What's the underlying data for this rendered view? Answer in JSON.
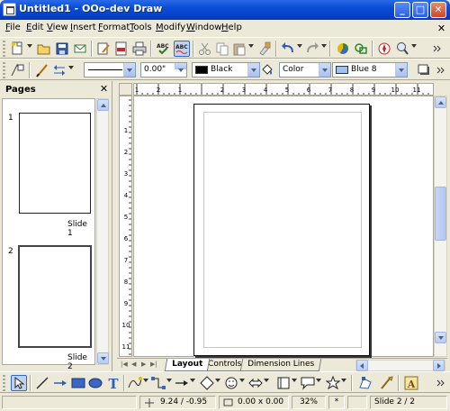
{
  "window": {
    "title": "Untitled1 - OOo-dev Draw",
    "buttons": {
      "minimize": "_",
      "maximize": "□",
      "close": "✕"
    }
  },
  "menu": {
    "items": [
      "File",
      "Edit",
      "View",
      "Insert",
      "Format",
      "Tools",
      "Modify",
      "Window",
      "Help"
    ],
    "close": "✕"
  },
  "line_toolbar": {
    "line_width": "0.00\"",
    "line_color": "Black",
    "area_style": "Color",
    "area_color": "Blue 8",
    "line_color_hex": "#000000",
    "area_color_hex": "#9fc3f0"
  },
  "pages_panel": {
    "title": "Pages",
    "close": "✕",
    "slides": [
      {
        "number": "1",
        "label": "Slide 1"
      },
      {
        "number": "2",
        "label": "Slide 2"
      }
    ]
  },
  "ruler": {
    "h_labels": [
      "1",
      "2",
      "1",
      "2",
      "3",
      "4",
      "5",
      "6",
      "7",
      "8",
      "9",
      "10",
      "11"
    ],
    "v_labels": [
      "1",
      "2",
      "3",
      "4",
      "5",
      "6",
      "7",
      "8",
      "9",
      "10",
      "11"
    ]
  },
  "tabs": [
    "Layout",
    "Controls",
    "Dimension Lines"
  ],
  "status": {
    "position": "9.24 / -0.95",
    "size": "0.00 x 0.00",
    "zoom": "32%",
    "modified": "*",
    "slide": "Slide 2 / 2"
  },
  "icons": {
    "toolbar1": [
      "new-icon",
      "open-icon",
      "save-icon",
      "email-icon",
      "edit-file-icon",
      "export-pdf-icon",
      "print-icon",
      "spellcheck-icon",
      "autospellcheck-icon",
      "cut-icon",
      "copy-icon",
      "paste-icon",
      "clone-format-icon",
      "undo-icon",
      "redo-icon",
      "chart-icon",
      "draw-functions-icon",
      "navigator-icon",
      "zoom-icon"
    ],
    "drawing": [
      "select-icon",
      "line-icon",
      "arrow-line-icon",
      "rectangle-icon",
      "ellipse-icon",
      "text-icon",
      "curve-icon",
      "connector-icon",
      "lines-arrows-icon",
      "basic-shapes-icon",
      "symbol-shapes-icon",
      "block-arrows-icon",
      "flowchart-icon",
      "callouts-icon",
      "stars-icon",
      "points-icon",
      "glue-points-icon",
      "fontwork-icon"
    ]
  }
}
